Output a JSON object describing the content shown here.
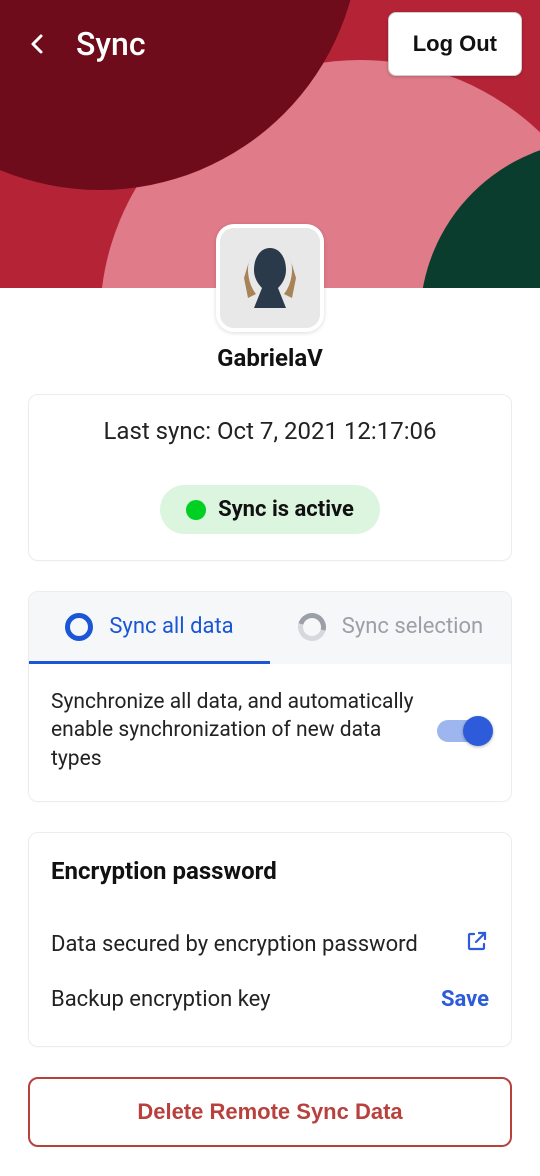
{
  "header": {
    "title": "Sync",
    "logout_label": "Log Out"
  },
  "profile": {
    "username": "GabrielaV"
  },
  "sync_status": {
    "last_sync_label": "Last sync: Oct 7, 2021 12:17:06",
    "badge_text": "Sync is active"
  },
  "tabs": {
    "all": {
      "label": "Sync all data"
    },
    "selection": {
      "label": "Sync selection"
    },
    "body_text": "Synchronize all data, and automatically enable synchronization of new data types"
  },
  "encryption": {
    "title": "Encryption password",
    "secured_label": "Data secured by encryption password",
    "backup_label": "Backup encryption key",
    "save_label": "Save"
  },
  "delete": {
    "label": "Delete Remote Sync Data"
  }
}
